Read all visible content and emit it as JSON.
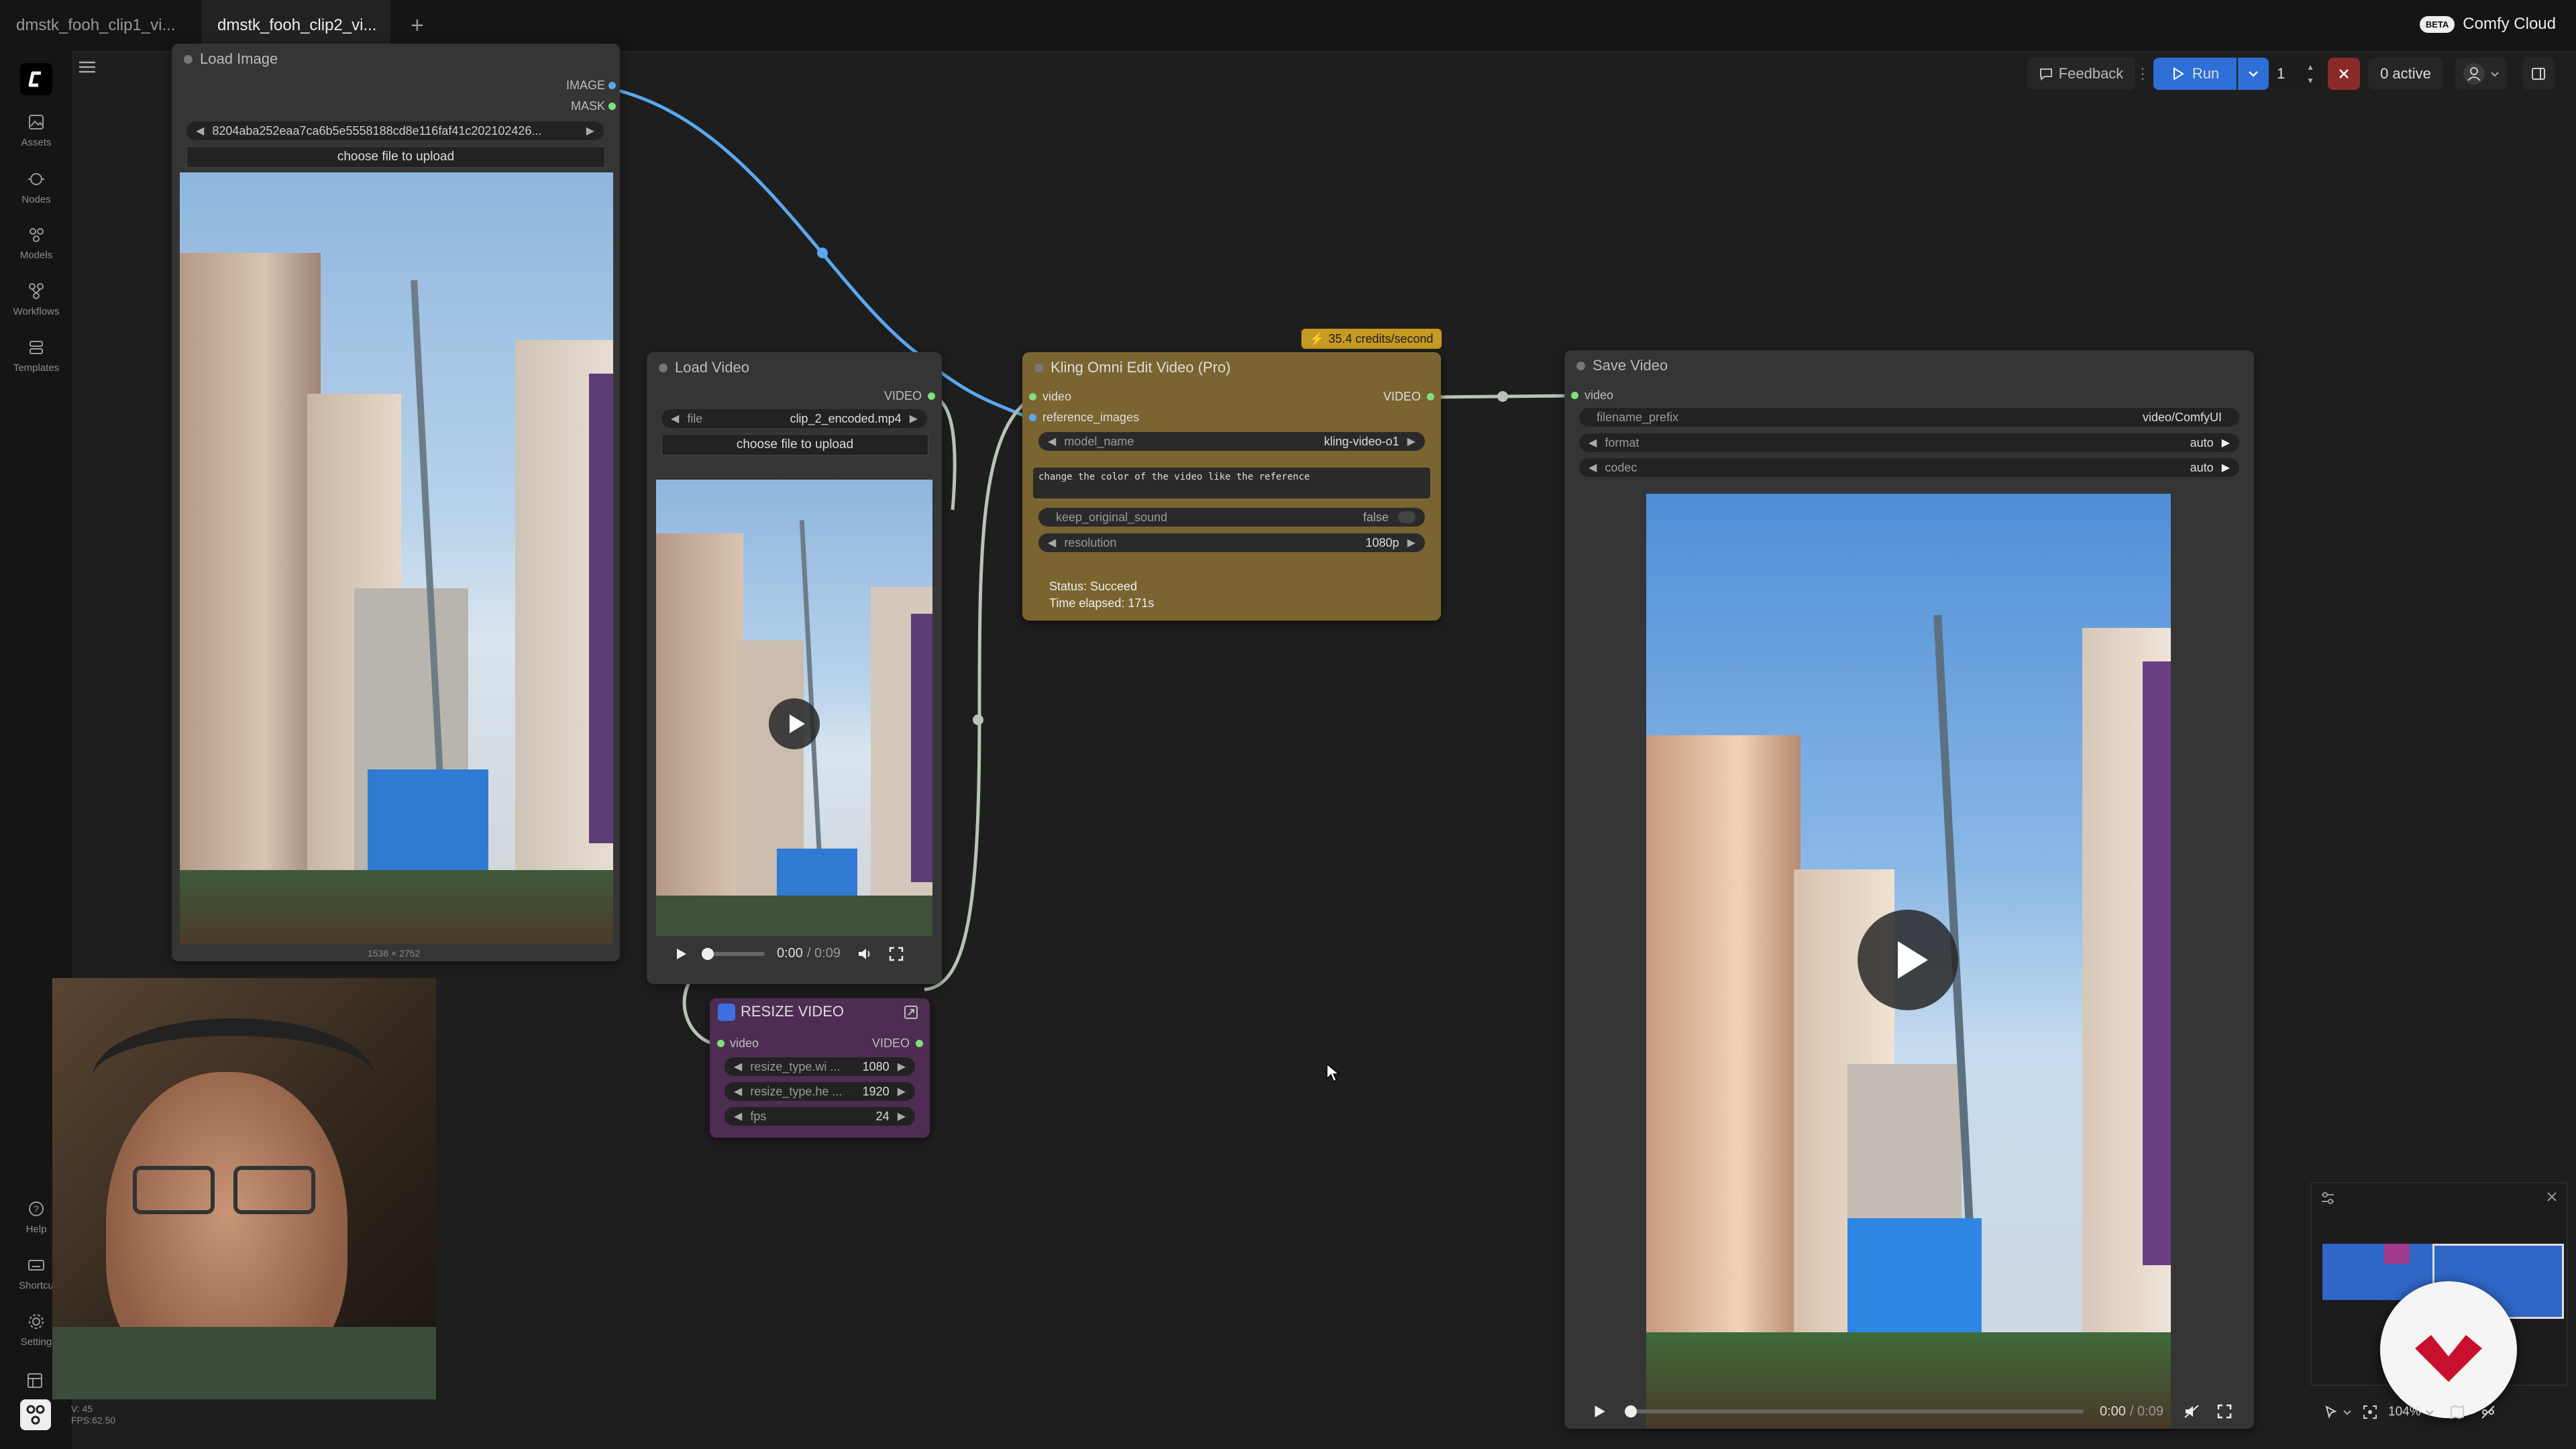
{
  "tabs": [
    {
      "label": "dmstk_fooh_clip1_vi...",
      "active": false
    },
    {
      "label": "dmstk_fooh_clip2_vi...",
      "active": true,
      "unsaved": true
    }
  ],
  "brand": {
    "badge": "BETA",
    "name": "Comfy Cloud"
  },
  "sidebar": {
    "items": [
      {
        "label": "Assets",
        "icon": "image-icon"
      },
      {
        "label": "Nodes",
        "icon": "nodes-icon"
      },
      {
        "label": "Models",
        "icon": "models-icon"
      },
      {
        "label": "Workflows",
        "icon": "workflow-icon"
      },
      {
        "label": "Templates",
        "icon": "template-icon"
      }
    ],
    "bottom": [
      {
        "label": "Help",
        "icon": "help-icon"
      },
      {
        "label": "Shortcu",
        "icon": "keyboard-icon"
      },
      {
        "label": "Setting",
        "icon": "gear-icon"
      }
    ]
  },
  "toolbar": {
    "feedback": "Feedback",
    "run": "Run",
    "count": "1",
    "active": "0 active"
  },
  "nodes": {
    "load_image": {
      "title": "Load Image",
      "outputs": [
        "IMAGE",
        "MASK"
      ],
      "filename": "8204aba252eaa7ca6b5e5558188cd8e116faf41c202102426...",
      "upload": "choose file to upload",
      "dims": "1536 × 2752"
    },
    "load_video": {
      "title": "Load Video",
      "output": "VIDEO",
      "file_label": "file",
      "file_value": "clip_2_encoded.mp4",
      "upload": "choose file to upload",
      "time": "0:00",
      "duration": "/ 0:09"
    },
    "kling": {
      "title": "Kling Omni Edit Video (Pro)",
      "badge": "35.4 credits/second",
      "inputs": [
        "video",
        "reference_images"
      ],
      "output": "VIDEO",
      "model_label": "model_name",
      "model_value": "kling-video-o1",
      "prompt": "change the color of the video like the reference",
      "sound_label": "keep_original_sound",
      "sound_value": "false",
      "res_label": "resolution",
      "res_value": "1080p",
      "status": "Status: Succeed",
      "elapsed": "Time elapsed: 171s"
    },
    "resize": {
      "title": "RESIZE VIDEO",
      "input": "video",
      "output": "VIDEO",
      "w_label": "resize_type.wi ...",
      "w_value": "1080",
      "h_label": "resize_type.he ...",
      "h_value": "1920",
      "fps_label": "fps",
      "fps_value": "24"
    },
    "save_video": {
      "title": "Save Video",
      "input": "video",
      "prefix_label": "filename_prefix",
      "prefix_value": "video/ComfyUI",
      "format_label": "format",
      "format_value": "auto",
      "codec_label": "codec",
      "codec_value": "auto",
      "time": "0:00",
      "duration": "/ 0:09"
    }
  },
  "stats": {
    "v": "V: 45",
    "fps": "FPS:62.50"
  },
  "zoom": "104%",
  "colors": {
    "kling_bg": "#7a6530",
    "resize_bg": "#4e2d52",
    "link_blue": "#5aa8f0",
    "run_blue": "#2d6fd6"
  }
}
